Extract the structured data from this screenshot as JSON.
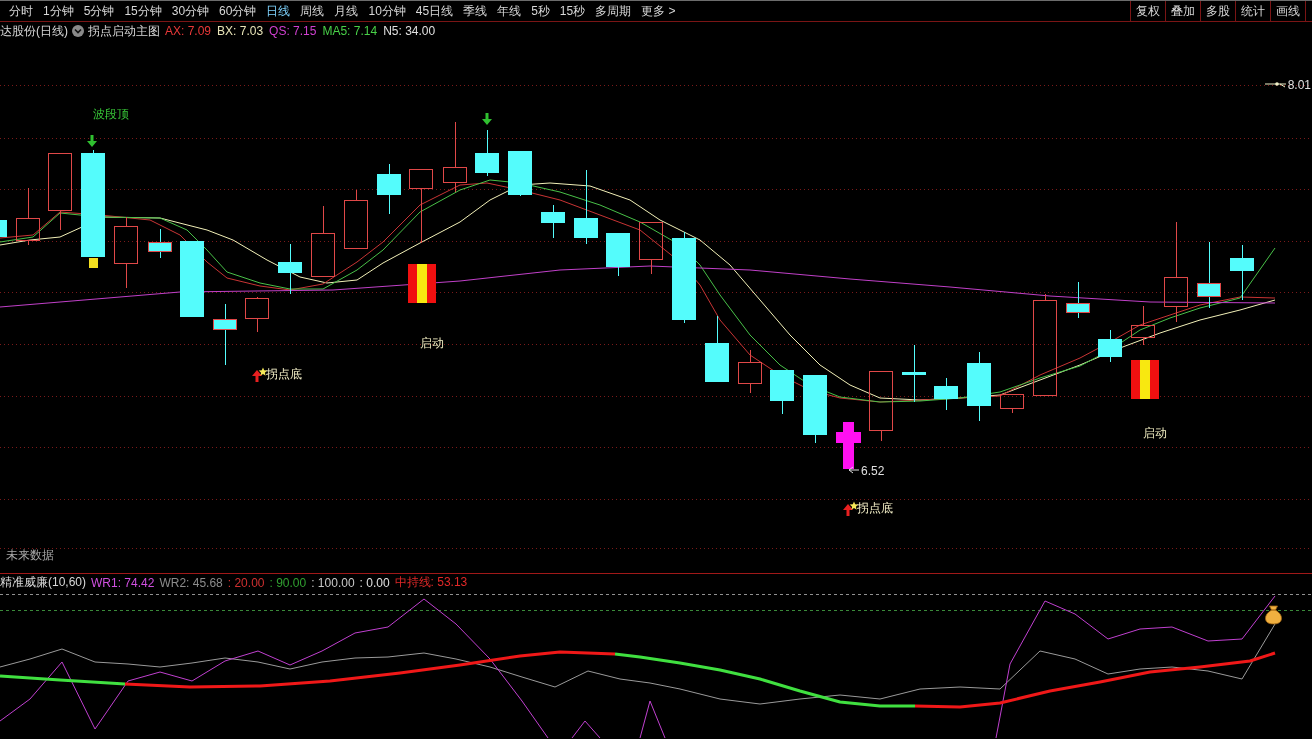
{
  "toolbar": {
    "periods": [
      {
        "label": "分时",
        "selected": false
      },
      {
        "label": "1分钟",
        "selected": false
      },
      {
        "label": "5分钟",
        "selected": false
      },
      {
        "label": "15分钟",
        "selected": false
      },
      {
        "label": "30分钟",
        "selected": false
      },
      {
        "label": "60分钟",
        "selected": false
      },
      {
        "label": "日线",
        "selected": true
      },
      {
        "label": "周线",
        "selected": false
      },
      {
        "label": "月线",
        "selected": false
      },
      {
        "label": "10分钟",
        "selected": false
      },
      {
        "label": "45日线",
        "selected": false
      },
      {
        "label": "季线",
        "selected": false
      },
      {
        "label": "年线",
        "selected": false
      },
      {
        "label": "5秒",
        "selected": false
      },
      {
        "label": "15秒",
        "selected": false
      },
      {
        "label": "多周期",
        "selected": false
      },
      {
        "label": "更多 >",
        "selected": false
      }
    ],
    "tools": [
      "复权",
      "叠加",
      "多股",
      "统计",
      "画线"
    ]
  },
  "chart_header": {
    "title": "达股份(日线)",
    "indicator": "拐点启动主图",
    "values": [
      {
        "text": "AX: 7.09",
        "color": "#e83838"
      },
      {
        "text": "BX: 7.03",
        "color": "#e8e4b8"
      },
      {
        "text": "QS: 7.15",
        "color": "#d040d0"
      },
      {
        "text": "MA5: 7.14",
        "color": "#48d048"
      },
      {
        "text": "N5: 34.00",
        "color": "#e0e0e0"
      }
    ]
  },
  "main_chart": {
    "high_label": "8.01",
    "signals": [
      {
        "kind": "top",
        "text": "波段顶"
      },
      {
        "kind": "bottom",
        "text": "拐点底"
      },
      {
        "kind": "start",
        "text": "启动"
      },
      {
        "kind": "bottom",
        "text": "拐点底"
      },
      {
        "kind": "start",
        "text": "启动"
      }
    ],
    "low_label": "6.52",
    "footnote": "未来数据"
  },
  "indicator_pane": {
    "title": "精准威廉(10,60)",
    "values": [
      {
        "text": "WR1: 74.42",
        "color": "#d050e0"
      },
      {
        "text": "WR2: 45.68",
        "color": "#8c8c8c"
      },
      {
        "text": ": 20.00",
        "color": "#d03030"
      },
      {
        "text": ": 90.00",
        "color": "#30a030"
      },
      {
        "text": ": 100.00",
        "color": "#c8c8c8"
      },
      {
        "text": ": 0.00",
        "color": "#e0e0e0"
      },
      {
        "text": "中持线: 53.13",
        "color": "#e02828"
      }
    ]
  }
}
